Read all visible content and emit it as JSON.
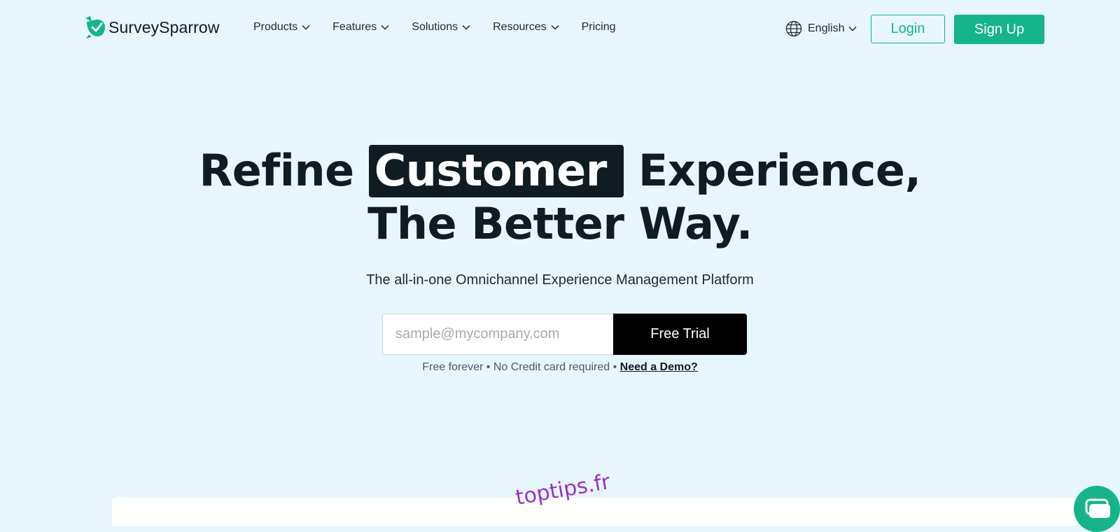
{
  "brand": {
    "name": "SurveySparrow",
    "accent_color": "#16b48a",
    "logo_icon": "sparrow-check-icon"
  },
  "nav": {
    "items": [
      {
        "label": "Products",
        "dropdown": true
      },
      {
        "label": "Features",
        "dropdown": true
      },
      {
        "label": "Solutions",
        "dropdown": true
      },
      {
        "label": "Resources",
        "dropdown": true
      },
      {
        "label": "Pricing",
        "dropdown": false
      }
    ]
  },
  "language": {
    "label": "English",
    "icon": "globe-icon"
  },
  "auth": {
    "login_label": "Login",
    "signup_label": "Sign Up"
  },
  "hero": {
    "title_pre": "Refine ",
    "title_highlight": "Customer",
    "title_post": " Experience,",
    "title_line2": "The Better Way.",
    "subtitle": "The all-in-one Omnichannel Experience Management Platform",
    "email_placeholder": "sample@mycompany.com",
    "email_value": "",
    "cta_label": "Free Trial",
    "note_text": "Free forever • No Credit card required • ",
    "demo_link": "Need a Demo?"
  },
  "watermark": "toptips.fr",
  "chat": {
    "icon": "chat-bubble-icon"
  }
}
